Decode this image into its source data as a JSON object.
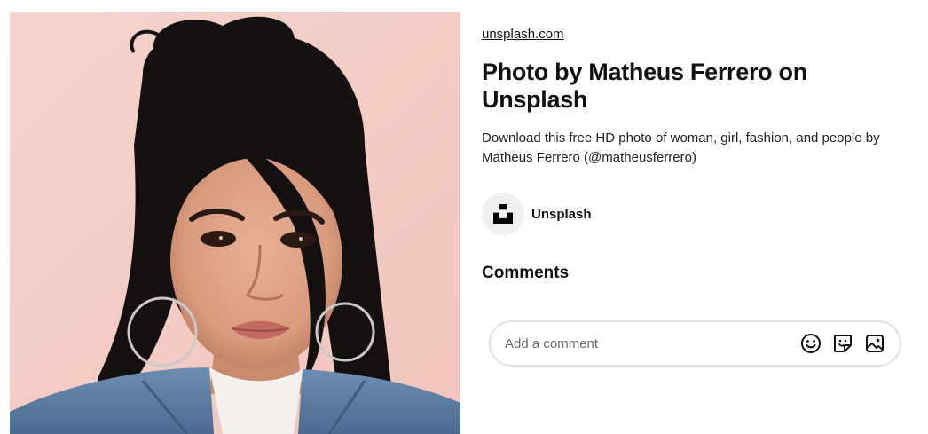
{
  "photo": {
    "subject": "woman with dark hair in a topknot, hoop earrings and denim jacket against a pink wall"
  },
  "pin": {
    "source_link": "unsplash.com",
    "title": "Photo by Matheus Ferrero on Unsplash",
    "description": "Download this free HD photo of woman, girl, fashion, and people by Matheus Ferrero (@matheusferrero)"
  },
  "author": {
    "name": "Unsplash",
    "avatar_icon": "unsplash-logo-icon"
  },
  "comments": {
    "heading": "Comments",
    "input_placeholder": "Add a comment",
    "icons": [
      "emoji-icon",
      "sticker-icon",
      "image-icon"
    ]
  },
  "colors": {
    "text": "#111111",
    "photo_background": "#f4cdc6",
    "input_border": "#e2e2e2",
    "avatar_background": "#f0f0f0"
  }
}
